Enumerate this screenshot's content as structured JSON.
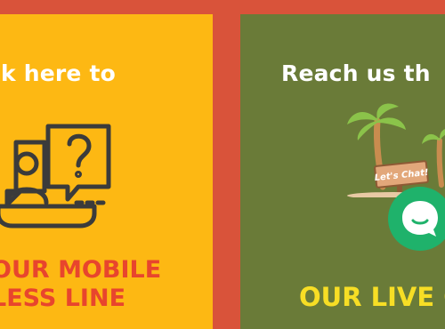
{
  "left_card": {
    "headline": "ck here to",
    "label_line1": "OUR MOBILE",
    "label_line2": "LESS LINE"
  },
  "right_card": {
    "headline": "Reach us th",
    "sign_text": "Let's Chat!",
    "label": "OUR LIVE C"
  },
  "colors": {
    "page_background": "#d9533a",
    "left_card": "#fdb813",
    "right_card": "#6a7b38",
    "left_label": "#e8452d",
    "right_label": "#f7de25",
    "chat_button": "#1fb26b"
  },
  "icons": {
    "left": "support-chat-icon",
    "chat_button": "chat-bubble-icon",
    "illustration": "palm-trees-lets-chat-sign"
  }
}
